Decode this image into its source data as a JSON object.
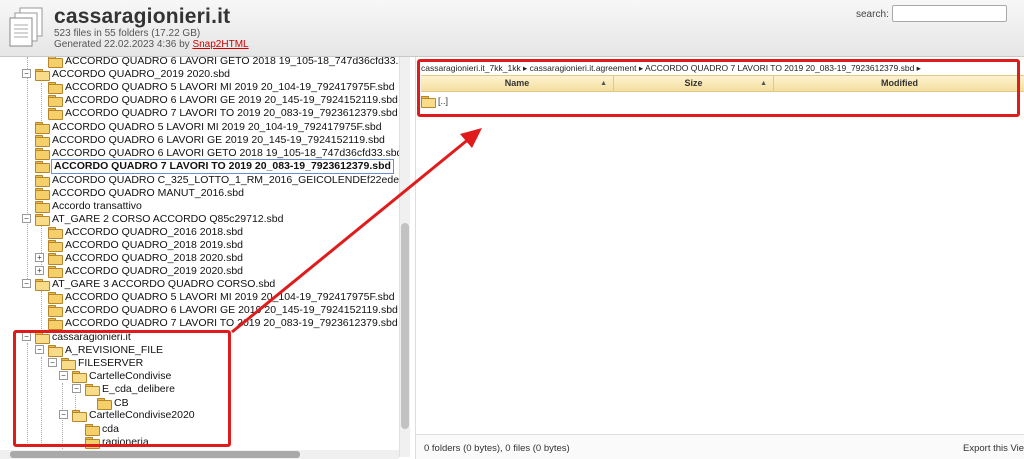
{
  "header": {
    "title": "cassaragionieri.it",
    "info_line1": "523 files in 55 folders (17.22 GB)",
    "generated_prefix": "Generated 22.02.2023 4:36 by ",
    "generator_link": "Snap2HTML",
    "search_label": "search:",
    "search_value": "",
    "icon": "file-stack-icon"
  },
  "tree": {
    "items": [
      {
        "label": "ACCORDO QUADRO 6 LAVORI GETO 2018 19_105-18_747d36cfd33.sbd"
      },
      {
        "label": "ACCORDO QUADRO_2019 2020.sbd"
      },
      {
        "label": "ACCORDO QUADRO 5 LAVORI MI 2019 20_104-19_792417975F.sbd"
      },
      {
        "label": "ACCORDO QUADRO 6 LAVORI GE 2019 20_145-19_7924152119.sbd"
      },
      {
        "label": "ACCORDO QUADRO 7 LAVORI TO 2019 20_083-19_7923612379.sbd"
      },
      {
        "label": "ACCORDO QUADRO 5 LAVORI MI 2019 20_104-19_792417975F.sbd"
      },
      {
        "label": "ACCORDO QUADRO 6 LAVORI GE 2019 20_145-19_7924152119.sbd"
      },
      {
        "label": "ACCORDO QUADRO 6 LAVORI GETO 2018 19_105-18_747d36cfd33.sbd"
      },
      {
        "label": "ACCORDO QUADRO 7 LAVORI TO 2019 20_083-19_7923612379.sbd"
      },
      {
        "label": "ACCORDO QUADRO C_325_LOTTO_1_RM_2016_GEICOLENDEf22edeba.sbd"
      },
      {
        "label": "ACCORDO QUADRO MANUT_2016.sbd"
      },
      {
        "label": "Accordo transattivo"
      },
      {
        "label": "AT_GARE 2 CORSO ACCORDO Q85c29712.sbd"
      },
      {
        "label": "ACCORDO QUADRO_2016 2018.sbd"
      },
      {
        "label": "ACCORDO QUADRO_2018 2019.sbd"
      },
      {
        "label": "ACCORDO QUADRO_2018 2020.sbd"
      },
      {
        "label": "ACCORDO QUADRO_2019 2020.sbd"
      },
      {
        "label": "AT_GARE 3 ACCORDO QUADRO CORSO.sbd"
      },
      {
        "label": "ACCORDO QUADRO 5 LAVORI MI 2019 20_104-19_792417975F.sbd"
      },
      {
        "label": "ACCORDO QUADRO 6 LAVORI GE 2019 20_145-19_7924152119.sbd"
      },
      {
        "label": "ACCORDO QUADRO 7 LAVORI TO 2019 20_083-19_7923612379.sbd"
      },
      {
        "label": "cassaragionieri.it"
      },
      {
        "label": "A_REVISIONE_FILE"
      },
      {
        "label": "FILESERVER"
      },
      {
        "label": "CartelleCondivise"
      },
      {
        "label": "E_cda_delibere"
      },
      {
        "label": "CB"
      },
      {
        "label": "CartelleCondivise2020"
      },
      {
        "label": "cda"
      },
      {
        "label": "ragioneria"
      }
    ]
  },
  "content": {
    "breadcrumb": "cassaragionieri.it_7kk_1kk ▸ cassaragionieri.it.agreement ▸ ACCORDO QUADRO 7 LAVORI TO 2019 20_083-19_7923612379.sbd ▸",
    "columns": {
      "name": "Name",
      "size": "Size",
      "modified": "Modified"
    },
    "parent_row": "[..]",
    "status": "0 folders (0 bytes), 0 files (0 bytes)",
    "export": "Export this Vie"
  },
  "annotation_color": "#e01b1b"
}
